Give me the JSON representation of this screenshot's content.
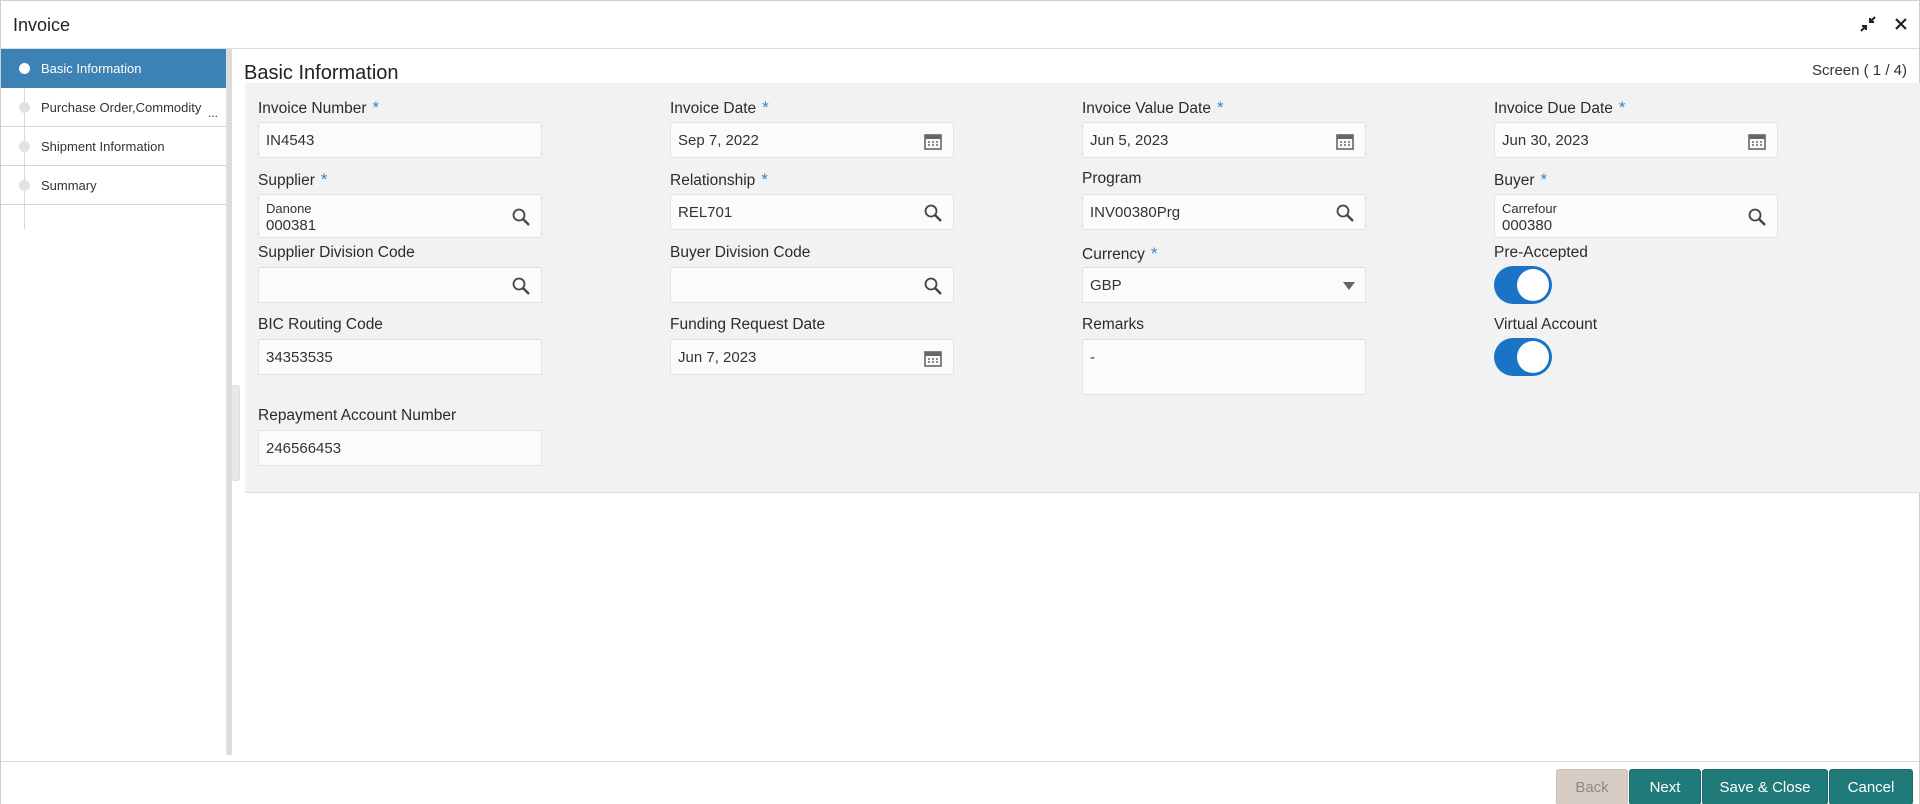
{
  "window": {
    "title": "Invoice"
  },
  "sidebar": {
    "steps": [
      {
        "label": "Basic Information",
        "active": true
      },
      {
        "label": "Purchase Order,Commodity",
        "more": "...",
        "active": false
      },
      {
        "label": "Shipment Information",
        "active": false
      },
      {
        "label": "Summary",
        "active": false
      }
    ]
  },
  "header": {
    "section_title": "Basic Information",
    "screen_indicator": "Screen ( 1 / 4)"
  },
  "form": {
    "required_mark": "*",
    "invoice_number": {
      "label": "Invoice Number",
      "value": "IN4543"
    },
    "invoice_date": {
      "label": "Invoice Date",
      "value": "Sep 7, 2022"
    },
    "invoice_value_date": {
      "label": "Invoice Value Date",
      "value": "Jun 5, 2023"
    },
    "invoice_due_date": {
      "label": "Invoice Due Date",
      "value": "Jun 30, 2023"
    },
    "supplier": {
      "label": "Supplier",
      "name": "Danone",
      "value": "000381"
    },
    "relationship": {
      "label": "Relationship",
      "value": "REL701"
    },
    "program": {
      "label": "Program",
      "value": "INV00380Prg"
    },
    "buyer": {
      "label": "Buyer",
      "name": "Carrefour",
      "value": "000380"
    },
    "supplier_division_code": {
      "label": "Supplier Division Code",
      "value": ""
    },
    "buyer_division_code": {
      "label": "Buyer Division Code",
      "value": ""
    },
    "currency": {
      "label": "Currency",
      "value": "GBP"
    },
    "pre_accepted": {
      "label": "Pre-Accepted",
      "on": true
    },
    "bic_routing_code": {
      "label": "BIC Routing Code",
      "value": "34353535"
    },
    "funding_request_date": {
      "label": "Funding Request Date",
      "value": "Jun 7, 2023"
    },
    "remarks": {
      "label": "Remarks",
      "value": "-"
    },
    "virtual_account": {
      "label": "Virtual Account",
      "on": true
    },
    "repayment_account_number": {
      "label": "Repayment Account Number",
      "value": "246566453"
    }
  },
  "footer": {
    "back": "Back",
    "next": "Next",
    "save_close": "Save & Close",
    "cancel": "Cancel"
  },
  "colors": {
    "accent": "#3d82b5",
    "toggle": "#1a73c4",
    "button": "#1f7a79",
    "required": "#3a86c8"
  }
}
